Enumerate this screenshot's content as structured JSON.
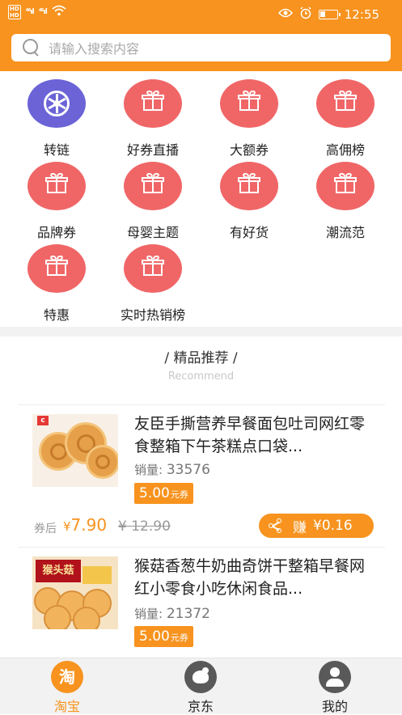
{
  "status_bar": {
    "time": "12:55",
    "network_1": "⁴⁶ıl",
    "network_2": "⁴⁶ıl"
  },
  "search": {
    "placeholder": "请输入搜索内容"
  },
  "categories": [
    {
      "label": "转链",
      "icon": "wheel-icon",
      "color": "#6b63d6"
    },
    {
      "label": "好券直播",
      "icon": "gift-icon",
      "color": "#f06667"
    },
    {
      "label": "大额券",
      "icon": "gift-icon",
      "color": "#f06667"
    },
    {
      "label": "高佣榜",
      "icon": "gift-icon",
      "color": "#f06667"
    },
    {
      "label": "品牌券",
      "icon": "gift-icon",
      "color": "#f06667"
    },
    {
      "label": "母婴主题",
      "icon": "gift-icon",
      "color": "#f06667"
    },
    {
      "label": "有好货",
      "icon": "gift-icon",
      "color": "#f06667"
    },
    {
      "label": "潮流范",
      "icon": "gift-icon",
      "color": "#f06667"
    },
    {
      "label": "特惠",
      "icon": "gift-icon",
      "color": "#f06667"
    },
    {
      "label": "实时热销榜",
      "icon": "gift-icon",
      "color": "#f06667"
    }
  ],
  "recommend": {
    "title": "/  精品推荐  /",
    "subtitle": "Recommend"
  },
  "products": [
    {
      "title": "友臣手撕营养早餐面包吐司网红零食整箱下午茶糕点口袋...",
      "sales_label": "销量:",
      "sales": "33576",
      "coupon_amount": "5.00",
      "coupon_unit": "元券",
      "after_label": "券后",
      "price_symbol": "¥",
      "price": "7.90",
      "original_price": "¥ 12.90",
      "earn_label": "赚",
      "earn_value": "¥0.16"
    },
    {
      "title": "猴菇香葱牛奶曲奇饼干整箱早餐网红小零食小吃休闲食品...",
      "sales_label": "销量:",
      "sales": "21372",
      "coupon_amount": "5.00",
      "coupon_unit": "元券",
      "box_text": "猴头菇"
    }
  ],
  "tabbar": [
    {
      "label": "淘宝",
      "icon_text": "淘",
      "active": true
    },
    {
      "label": "京东"
    },
    {
      "label": "我的"
    }
  ],
  "colors": {
    "brand": "#f7931e",
    "category_red": "#f06667",
    "category_purple": "#6b63d6"
  }
}
